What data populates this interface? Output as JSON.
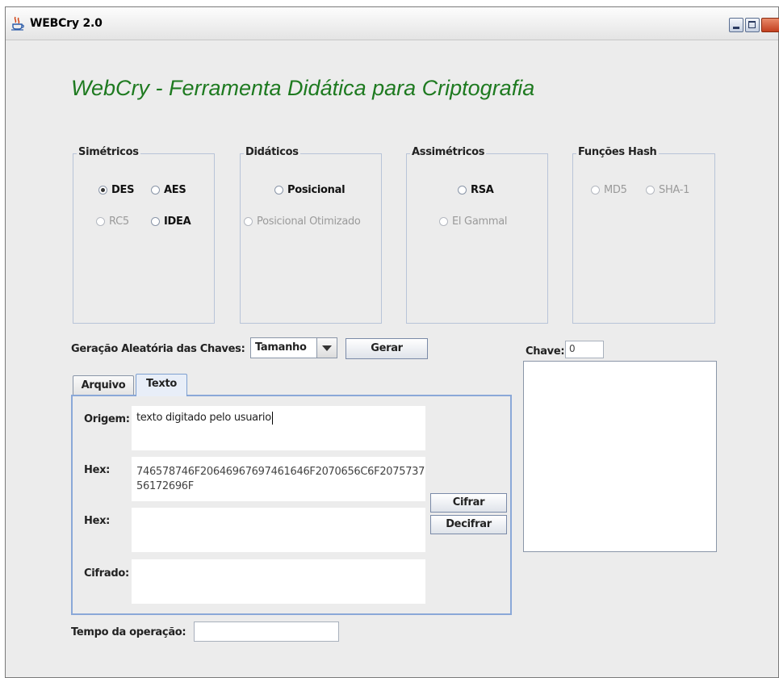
{
  "window": {
    "title": "WEBCry 2.0",
    "icon": "java-cup-icon"
  },
  "app_title": "WebCry -  Ferramenta Didática para Criptografia",
  "groups": {
    "simetricos": {
      "title": "Simétricos",
      "options": [
        "DES",
        "AES",
        "RC5",
        "IDEA"
      ],
      "selected": "DES"
    },
    "didaticos": {
      "title": "Didáticos",
      "options": [
        "Posicional",
        "Posicional Otimizado"
      ]
    },
    "assimetricos": {
      "title": "Assimétricos",
      "options": [
        "RSA",
        "El Gammal"
      ]
    },
    "hash": {
      "title": "Funções Hash",
      "options": [
        "MD5",
        "SHA-1"
      ]
    }
  },
  "keygen": {
    "label": "Geração Aleatória das Chaves:",
    "combo_value": "Tamanho",
    "button": "Gerar"
  },
  "key": {
    "label": "Chave:",
    "value": "0",
    "area_text": ""
  },
  "tabs": [
    {
      "label": "Arquivo",
      "active": false
    },
    {
      "label": "Texto",
      "active": true
    }
  ],
  "fields": {
    "origem": {
      "label": "Origem:",
      "value": "texto digitado pelo usuario"
    },
    "hex1": {
      "label": "Hex:",
      "value": "746578746F20646967697461646F2070656C6F207573756172696F"
    },
    "hex2": {
      "label": "Hex:",
      "value": ""
    },
    "cifrado": {
      "label": "Cifrado:",
      "value": ""
    }
  },
  "actions": {
    "cifrar": "Cifrar",
    "decifrar": "Decifrar"
  },
  "timing": {
    "label": "Tempo da operação:",
    "value": ""
  },
  "colors": {
    "title_green": "#1e7a20",
    "tab_border": "#8aa8d8"
  }
}
